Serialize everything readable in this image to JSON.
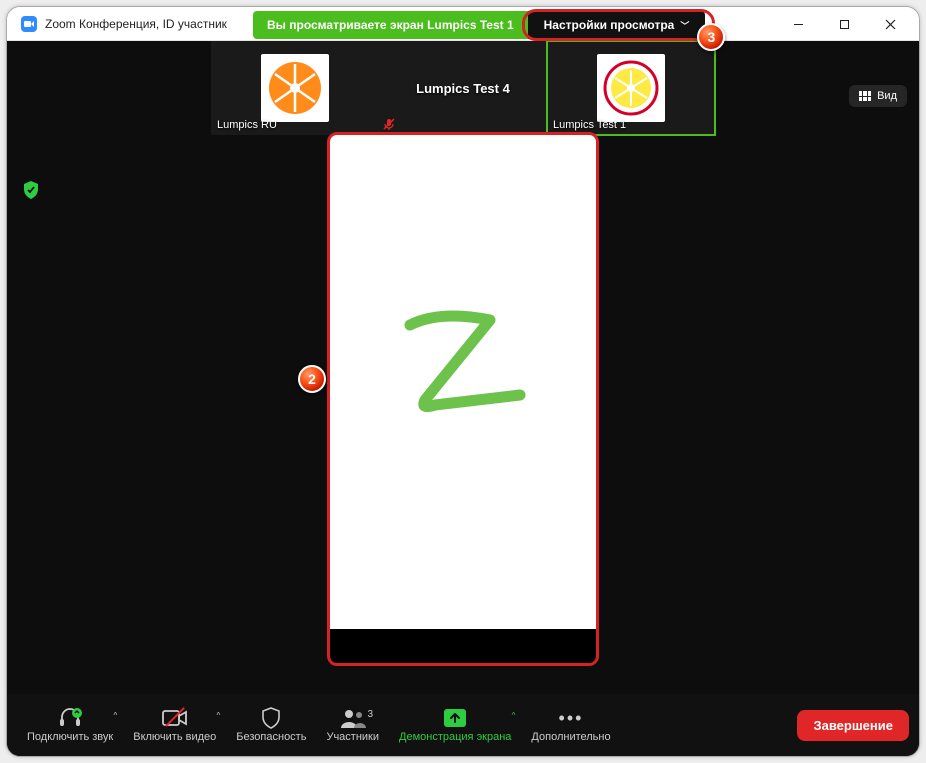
{
  "titlebar": {
    "title": "Zoom Конференция, ID участник"
  },
  "banner": {
    "msg": "Вы просматриваете экран Lumpics Test 1",
    "opts": "Настройки просмотра"
  },
  "view_btn": "Вид",
  "gallery": {
    "p1": "Lumpics RU",
    "p2": "Lumpics Test 4",
    "p3": "Lumpics Test 1"
  },
  "toolbar": {
    "audio": "Подключить звук",
    "video": "Включить видео",
    "security": "Безопасность",
    "participants": "Участники",
    "participants_count": "3",
    "share": "Демонстрация экрана",
    "more": "Дополнительно",
    "end": "Завершение"
  },
  "badges": {
    "b2": "2",
    "b3": "3"
  }
}
